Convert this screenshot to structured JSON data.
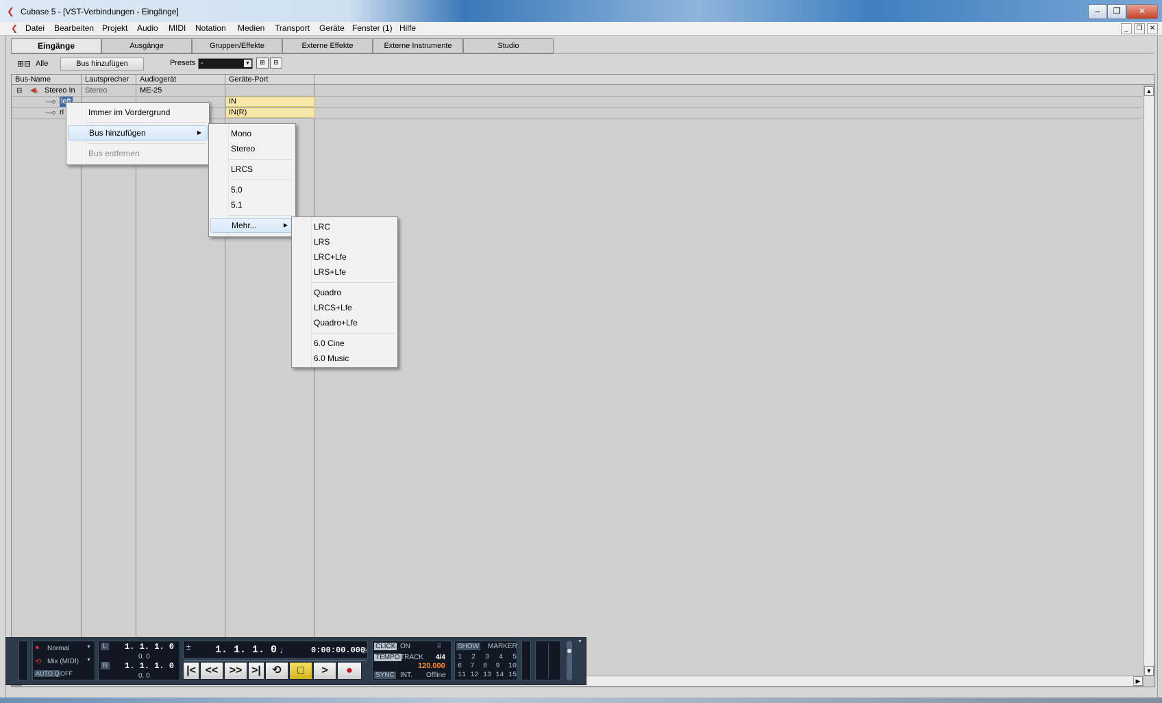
{
  "window": {
    "title": "Cubase 5 - [VST-Verbindungen - Eingänge]",
    "app_icon": "cubase-logo-icon",
    "controls": {
      "minimize": "–",
      "restore": "❐",
      "close": "✕"
    }
  },
  "menubar": {
    "items": [
      "Datei",
      "Bearbeiten",
      "Projekt",
      "Audio",
      "MIDI",
      "Notation",
      "Medien",
      "Transport",
      "Geräte",
      "Fenster (1)",
      "Hilfe"
    ],
    "mdi_controls": {
      "minimize": "_",
      "restore": "❐",
      "close": "✕"
    }
  },
  "tabs": [
    "Eingänge",
    "Ausgänge",
    "Gruppen/Effekte",
    "Externe Effekte",
    "Externe Instrumente",
    "Studio"
  ],
  "active_tab": "Eingänge",
  "toolbar": {
    "expand_all_label": "Alle",
    "add_bus_label": "Bus hinzufügen",
    "presets_label": "Presets",
    "presets_value": "-"
  },
  "grid": {
    "columns": [
      "Bus-Name",
      "Lautsprecher",
      "Audiogerät",
      "Geräte-Port"
    ],
    "bus": {
      "name": "Stereo In",
      "speaker": "Stereo",
      "device": "ME-25"
    },
    "channels": [
      {
        "name": "left",
        "port": "IN"
      },
      {
        "name": "ri",
        "port": "IN(R)"
      }
    ]
  },
  "context_menu": {
    "items": [
      {
        "label": "Immer im Vordergrund",
        "enabled": true
      },
      {
        "label": "Bus hinzufügen",
        "enabled": true,
        "submenu": true
      },
      {
        "label": "Bus entfernen",
        "enabled": false
      }
    ]
  },
  "submenu_bus": {
    "items": [
      "Mono",
      "Stereo",
      "LRCS",
      "5.0",
      "5.1",
      "Mehr..."
    ]
  },
  "submenu_more": {
    "items": [
      "LRC",
      "LRS",
      "LRC+Lfe",
      "LRS+Lfe",
      "Quadro",
      "LRCS+Lfe",
      "Quadro+Lfe",
      "6.0 Cine",
      "6.0 Music"
    ]
  },
  "transport": {
    "mode1": "Normal",
    "mode2": "Mix (MIDI)",
    "autoq": "AUTO Q",
    "autoq_state": "OFF",
    "left_locator": "1. 1. 1.   0",
    "left_sub": "0.    0",
    "right_locator": "1. 1. 1.   0",
    "right_sub": "0.    0",
    "position": "1. 1. 1.   0",
    "time": "0:00:00.000",
    "click_label": "CLICK",
    "click_state": "ON",
    "tempo_label": "TEMPO",
    "track_label": "TRACK",
    "signature": "4/4",
    "tempo": "120.000",
    "sync_label": "SYNC",
    "sync_int": "INT.",
    "sync_state": "Offline",
    "show_label": "SHOW",
    "marker_label": "MARKER",
    "marker_row1": [
      "1",
      "2",
      "3",
      "4",
      "5"
    ],
    "marker_row2": [
      "6",
      "7",
      "8",
      "9",
      "10"
    ],
    "marker_row3": [
      "11",
      "12",
      "13",
      "14",
      "15"
    ],
    "buttons": {
      "to_start": "|<",
      "rewind": "<<",
      "forward": ">>",
      "to_end": ">|",
      "cycle": "⟲",
      "stop": "□",
      "play": ">",
      "record": "●"
    }
  },
  "colors": {
    "port_highlight": "#f7e7a8",
    "transport_bg": "#2c3a4a",
    "tempo_color": "#ff8a2a",
    "record_color": "#d0101a",
    "stop_color": "#e6c93a"
  }
}
